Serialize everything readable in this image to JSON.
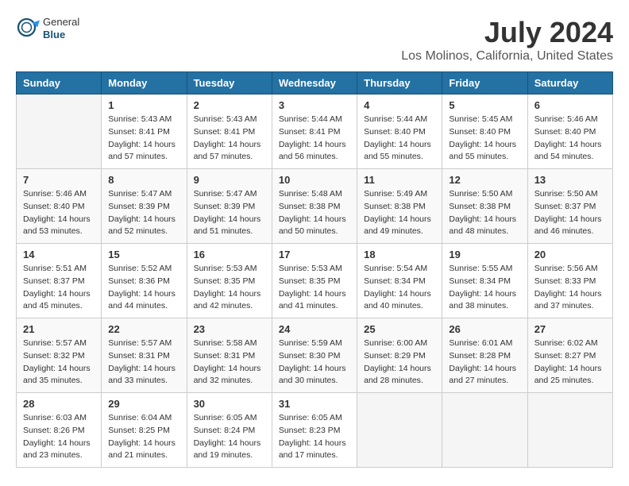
{
  "header": {
    "logo": {
      "line1": "General",
      "line2": "Blue"
    },
    "title": "July 2024",
    "subtitle": "Los Molinos, California, United States"
  },
  "calendar": {
    "headers": [
      "Sunday",
      "Monday",
      "Tuesday",
      "Wednesday",
      "Thursday",
      "Friday",
      "Saturday"
    ],
    "weeks": [
      [
        {
          "day": "",
          "info": ""
        },
        {
          "day": "1",
          "info": "Sunrise: 5:43 AM\nSunset: 8:41 PM\nDaylight: 14 hours\nand 57 minutes."
        },
        {
          "day": "2",
          "info": "Sunrise: 5:43 AM\nSunset: 8:41 PM\nDaylight: 14 hours\nand 57 minutes."
        },
        {
          "day": "3",
          "info": "Sunrise: 5:44 AM\nSunset: 8:41 PM\nDaylight: 14 hours\nand 56 minutes."
        },
        {
          "day": "4",
          "info": "Sunrise: 5:44 AM\nSunset: 8:40 PM\nDaylight: 14 hours\nand 55 minutes."
        },
        {
          "day": "5",
          "info": "Sunrise: 5:45 AM\nSunset: 8:40 PM\nDaylight: 14 hours\nand 55 minutes."
        },
        {
          "day": "6",
          "info": "Sunrise: 5:46 AM\nSunset: 8:40 PM\nDaylight: 14 hours\nand 54 minutes."
        }
      ],
      [
        {
          "day": "7",
          "info": "Sunrise: 5:46 AM\nSunset: 8:40 PM\nDaylight: 14 hours\nand 53 minutes."
        },
        {
          "day": "8",
          "info": "Sunrise: 5:47 AM\nSunset: 8:39 PM\nDaylight: 14 hours\nand 52 minutes."
        },
        {
          "day": "9",
          "info": "Sunrise: 5:47 AM\nSunset: 8:39 PM\nDaylight: 14 hours\nand 51 minutes."
        },
        {
          "day": "10",
          "info": "Sunrise: 5:48 AM\nSunset: 8:38 PM\nDaylight: 14 hours\nand 50 minutes."
        },
        {
          "day": "11",
          "info": "Sunrise: 5:49 AM\nSunset: 8:38 PM\nDaylight: 14 hours\nand 49 minutes."
        },
        {
          "day": "12",
          "info": "Sunrise: 5:50 AM\nSunset: 8:38 PM\nDaylight: 14 hours\nand 48 minutes."
        },
        {
          "day": "13",
          "info": "Sunrise: 5:50 AM\nSunset: 8:37 PM\nDaylight: 14 hours\nand 46 minutes."
        }
      ],
      [
        {
          "day": "14",
          "info": "Sunrise: 5:51 AM\nSunset: 8:37 PM\nDaylight: 14 hours\nand 45 minutes."
        },
        {
          "day": "15",
          "info": "Sunrise: 5:52 AM\nSunset: 8:36 PM\nDaylight: 14 hours\nand 44 minutes."
        },
        {
          "day": "16",
          "info": "Sunrise: 5:53 AM\nSunset: 8:35 PM\nDaylight: 14 hours\nand 42 minutes."
        },
        {
          "day": "17",
          "info": "Sunrise: 5:53 AM\nSunset: 8:35 PM\nDaylight: 14 hours\nand 41 minutes."
        },
        {
          "day": "18",
          "info": "Sunrise: 5:54 AM\nSunset: 8:34 PM\nDaylight: 14 hours\nand 40 minutes."
        },
        {
          "day": "19",
          "info": "Sunrise: 5:55 AM\nSunset: 8:34 PM\nDaylight: 14 hours\nand 38 minutes."
        },
        {
          "day": "20",
          "info": "Sunrise: 5:56 AM\nSunset: 8:33 PM\nDaylight: 14 hours\nand 37 minutes."
        }
      ],
      [
        {
          "day": "21",
          "info": "Sunrise: 5:57 AM\nSunset: 8:32 PM\nDaylight: 14 hours\nand 35 minutes."
        },
        {
          "day": "22",
          "info": "Sunrise: 5:57 AM\nSunset: 8:31 PM\nDaylight: 14 hours\nand 33 minutes."
        },
        {
          "day": "23",
          "info": "Sunrise: 5:58 AM\nSunset: 8:31 PM\nDaylight: 14 hours\nand 32 minutes."
        },
        {
          "day": "24",
          "info": "Sunrise: 5:59 AM\nSunset: 8:30 PM\nDaylight: 14 hours\nand 30 minutes."
        },
        {
          "day": "25",
          "info": "Sunrise: 6:00 AM\nSunset: 8:29 PM\nDaylight: 14 hours\nand 28 minutes."
        },
        {
          "day": "26",
          "info": "Sunrise: 6:01 AM\nSunset: 8:28 PM\nDaylight: 14 hours\nand 27 minutes."
        },
        {
          "day": "27",
          "info": "Sunrise: 6:02 AM\nSunset: 8:27 PM\nDaylight: 14 hours\nand 25 minutes."
        }
      ],
      [
        {
          "day": "28",
          "info": "Sunrise: 6:03 AM\nSunset: 8:26 PM\nDaylight: 14 hours\nand 23 minutes."
        },
        {
          "day": "29",
          "info": "Sunrise: 6:04 AM\nSunset: 8:25 PM\nDaylight: 14 hours\nand 21 minutes."
        },
        {
          "day": "30",
          "info": "Sunrise: 6:05 AM\nSunset: 8:24 PM\nDaylight: 14 hours\nand 19 minutes."
        },
        {
          "day": "31",
          "info": "Sunrise: 6:05 AM\nSunset: 8:23 PM\nDaylight: 14 hours\nand 17 minutes."
        },
        {
          "day": "",
          "info": ""
        },
        {
          "day": "",
          "info": ""
        },
        {
          "day": "",
          "info": ""
        }
      ]
    ]
  }
}
